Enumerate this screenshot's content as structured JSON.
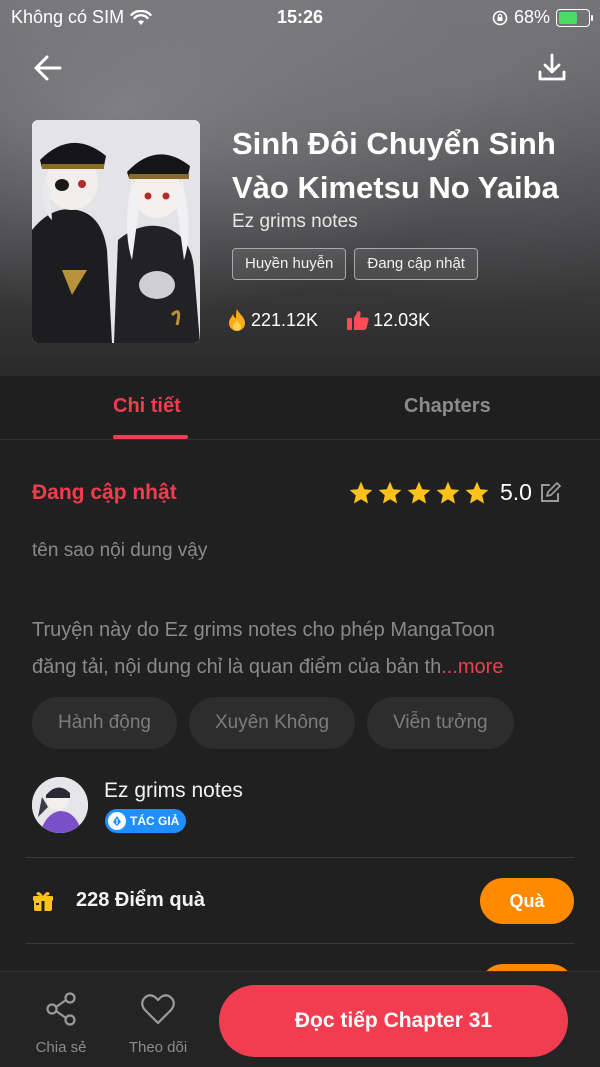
{
  "status_bar": {
    "carrier": "Không có SIM",
    "time": "15:26",
    "battery": "68%",
    "battery_level": 0.68
  },
  "header": {
    "back_icon": "arrow-left-icon",
    "download_icon": "download-icon"
  },
  "book": {
    "title_line1": "Sinh Đôi Chuyển Sinh",
    "title_line2": "Vào Kimetsu No Yaiba",
    "author": "Ez grims notes",
    "tags": [
      "Huyền huyễn",
      "Đang cập nhật"
    ],
    "views": "221.12K",
    "likes": "12.03K"
  },
  "tabs": {
    "detail": "Chi tiết",
    "chapters": "Chapters"
  },
  "detail": {
    "status": "Đang cập nhật",
    "rating_value": "5.0",
    "rating_stars": 5,
    "tagline": "tên sao nội dung vậy",
    "description_line1": "Truyện này do Ez grims notes cho phép MangaToon",
    "description_line2": "đăng tải, nội dung chỉ là quan điểm của bản th",
    "more": "...more",
    "genres": [
      "Hành động",
      "Xuyên Không",
      "Viễn tưởng"
    ]
  },
  "author_card": {
    "name": "Ez grims notes",
    "badge": "TÁC GIẢ"
  },
  "gift": {
    "points": "228 Điểm quà",
    "button": "Quà"
  },
  "bottom_bar": {
    "share": "Chia sẻ",
    "follow": "Theo dõi",
    "read": "Đọc tiếp Chapter 31"
  },
  "colors": {
    "accent": "#f23d50",
    "orange": "#ff8a00",
    "badge_blue": "#1f8fff",
    "star": "#ffc21a",
    "background": "#202020"
  }
}
